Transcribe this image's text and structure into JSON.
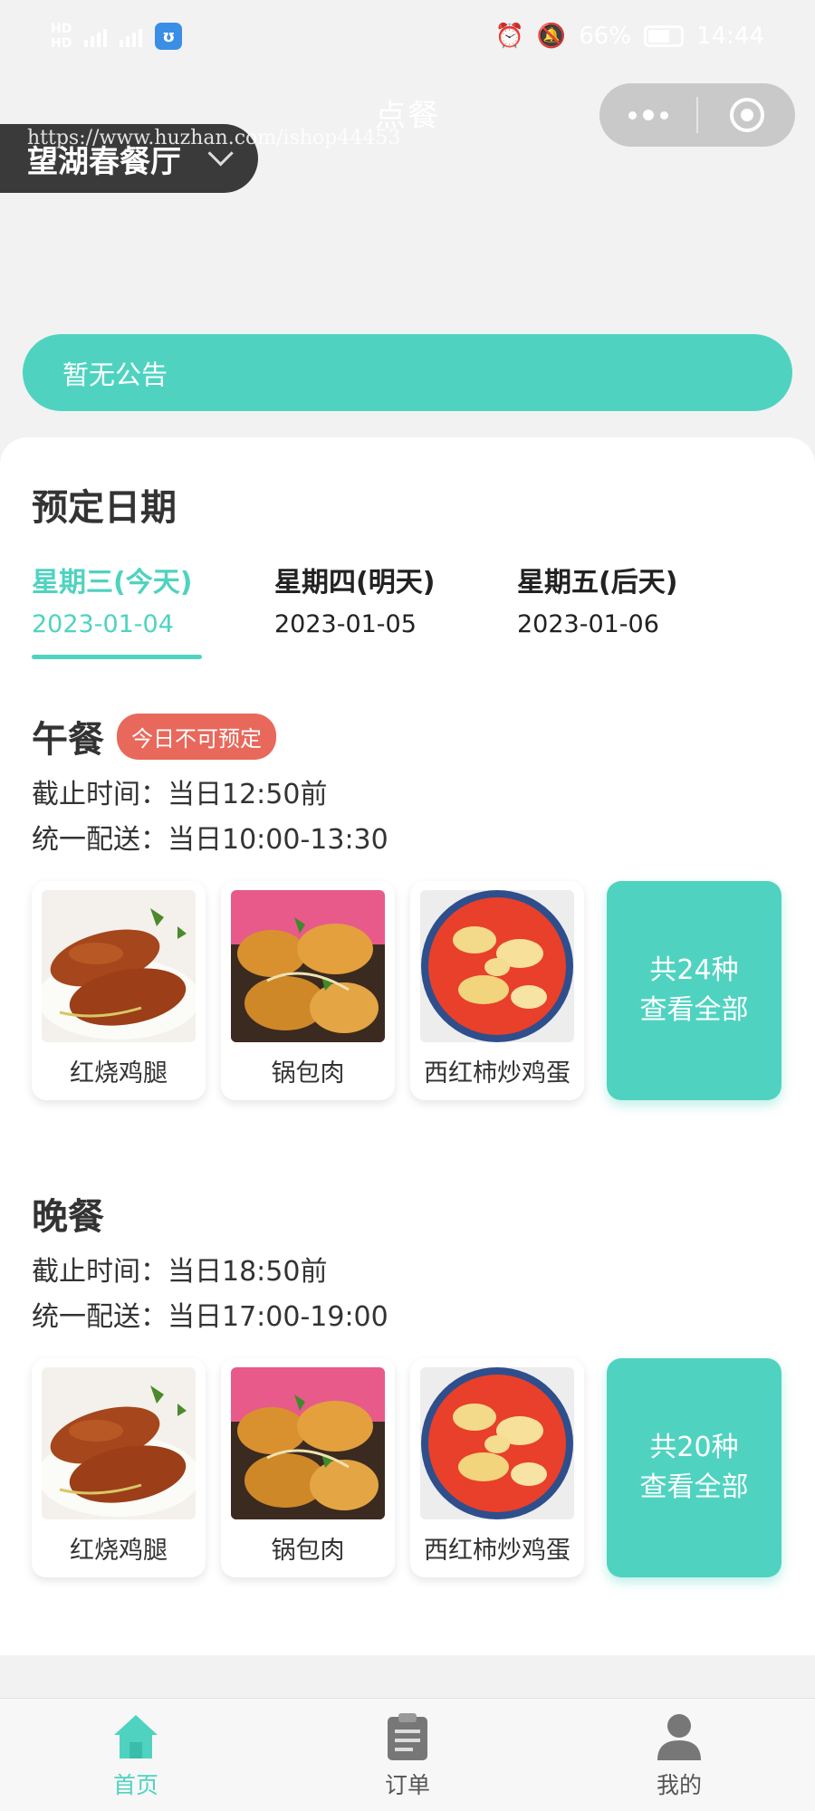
{
  "status_bar": {
    "net_top": "HD",
    "net_bottom": "HD",
    "battery": "66%",
    "time": "14:44"
  },
  "nav": {
    "title": "点餐",
    "restaurant": "望湖春餐厅",
    "watermark": "https://www.huzhan.com/ishop44453"
  },
  "notice": "暂无公告",
  "booking": {
    "title": "预定日期",
    "dates": [
      {
        "weekday": "星期三(今天)",
        "date": "2023-01-04",
        "active": true
      },
      {
        "weekday": "星期四(明天)",
        "date": "2023-01-05",
        "active": false
      },
      {
        "weekday": "星期五(后天)",
        "date": "2023-01-06",
        "active": false
      }
    ]
  },
  "meals": [
    {
      "name": "午餐",
      "badge": "今日不可预定",
      "deadline": "截止时间：当日12:50前",
      "delivery": "统一配送：当日10:00-13:30",
      "dishes": [
        "红烧鸡腿",
        "锅包肉",
        "西红柿炒鸡蛋"
      ],
      "total": "共24种",
      "view_all": "查看全部"
    },
    {
      "name": "晚餐",
      "badge": "",
      "deadline": "截止时间：当日18:50前",
      "delivery": "统一配送：当日17:00-19:00",
      "dishes": [
        "红烧鸡腿",
        "锅包肉",
        "西红柿炒鸡蛋"
      ],
      "total": "共20种",
      "view_all": "查看全部"
    }
  ],
  "tabbar": [
    {
      "label": "首页",
      "icon": "home-icon",
      "active": true
    },
    {
      "label": "订单",
      "icon": "clipboard-icon",
      "active": false
    },
    {
      "label": "我的",
      "icon": "user-icon",
      "active": false
    }
  ],
  "colors": {
    "accent": "#4fd3c0",
    "badge": "#e9685c",
    "restaurant_bg": "#3a3a3a"
  }
}
